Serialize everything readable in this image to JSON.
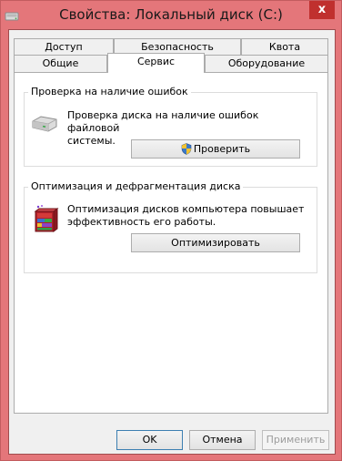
{
  "window": {
    "title": "Свойства: Локальный диск (C:)",
    "close_glyph": "x"
  },
  "tabs": {
    "row_top": [
      {
        "label": "Доступ"
      },
      {
        "label": "Безопасность"
      },
      {
        "label": "Квота"
      }
    ],
    "row_bottom": [
      {
        "label": "Общие"
      },
      {
        "label": "Сервис",
        "active": true
      },
      {
        "label": "Оборудование"
      }
    ]
  },
  "error_check": {
    "group_label": "Проверка на наличие ошибок",
    "description_line1": "Проверка диска на наличие ошибок файловой",
    "description_line2": "системы.",
    "button_label": "Проверить",
    "icon": "hard-drive-icon",
    "button_icon": "uac-shield-icon"
  },
  "optimize": {
    "group_label": "Оптимизация и дефрагментация диска",
    "description_line1": "Оптимизация дисков компьютера повышает",
    "description_line2": "эффективность его работы.",
    "button_label": "Оптимизировать",
    "icon": "defrag-icon"
  },
  "footer": {
    "ok_label": "OK",
    "cancel_label": "Отмена",
    "apply_label": "Применить",
    "apply_enabled": false
  },
  "colors": {
    "frame": "#e4767a",
    "close_button": "#c0302e",
    "client_bg": "#f0f0f0",
    "panel_bg": "#ffffff",
    "default_button_border": "#3c7fb1"
  }
}
